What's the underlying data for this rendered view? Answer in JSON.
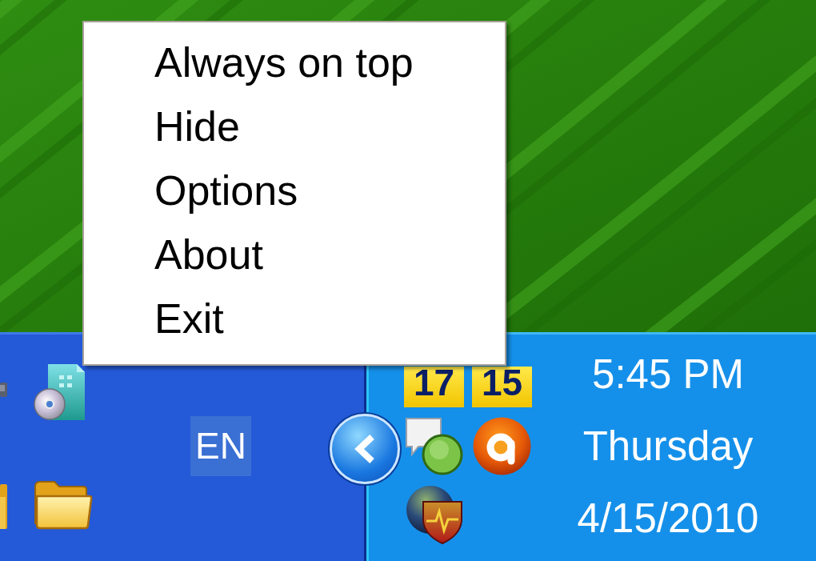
{
  "context_menu": {
    "items": [
      {
        "label": "Always on top"
      },
      {
        "label": "Hide"
      },
      {
        "label": "Options"
      },
      {
        "label": "About"
      },
      {
        "label": "Exit"
      }
    ]
  },
  "taskbar": {
    "language": "EN",
    "tray": {
      "counters": [
        "17",
        "15"
      ]
    },
    "clock": {
      "time": "5:45 PM",
      "day": "Thursday",
      "date": "4/15/2010"
    }
  }
}
